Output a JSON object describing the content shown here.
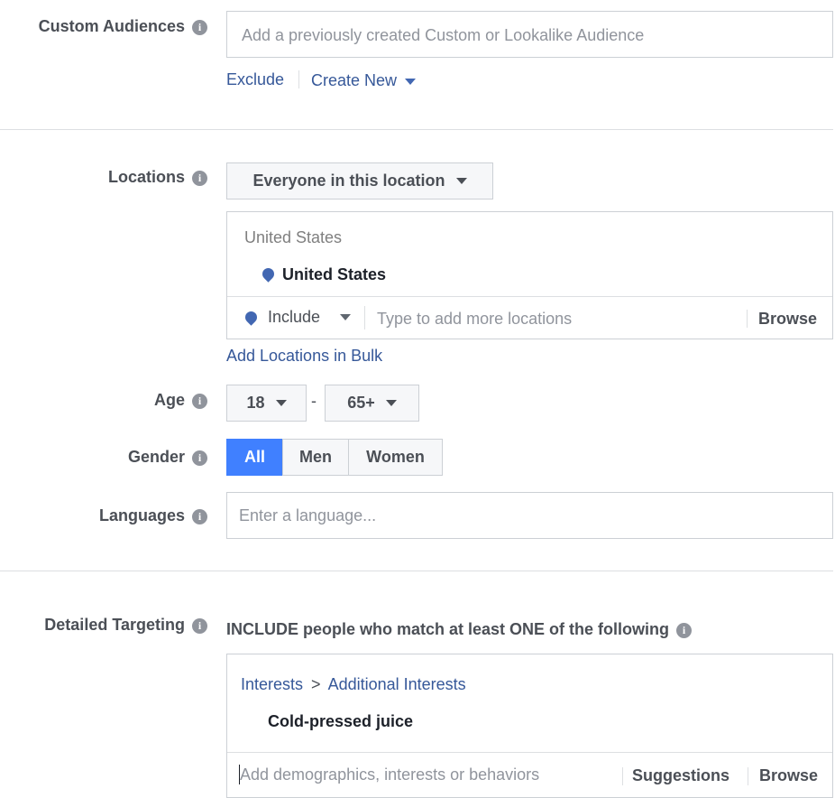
{
  "custom_audiences": {
    "label": "Custom Audiences",
    "info": "i",
    "placeholder": "Add a previously created Custom or Lookalike Audience",
    "exclude_label": "Exclude",
    "create_new_label": "Create New"
  },
  "locations": {
    "label": "Locations",
    "info": "i",
    "dropdown_label": "Everyone in this location",
    "group_header": "United States",
    "selected_location": "United States",
    "include_label": "Include",
    "input_placeholder": "Type to add more locations",
    "browse_label": "Browse",
    "bulk_link": "Add Locations in Bulk"
  },
  "age": {
    "label": "Age",
    "info": "i",
    "min": "18",
    "separator": "-",
    "max": "65+"
  },
  "gender": {
    "label": "Gender",
    "info": "i",
    "options": [
      "All",
      "Men",
      "Women"
    ],
    "selected": "All"
  },
  "languages": {
    "label": "Languages",
    "info": "i",
    "placeholder": "Enter a language..."
  },
  "detailed_targeting": {
    "label": "Detailed Targeting",
    "info": "i",
    "include_text": "INCLUDE people who match at least ONE of the following",
    "breadcrumb_root": "Interests",
    "breadcrumb_sep": ">",
    "breadcrumb_child": "Additional Interests",
    "selected_interest": "Cold-pressed juice",
    "input_placeholder": "Add demographics, interests or behaviors",
    "suggestions_label": "Suggestions",
    "browse_label": "Browse"
  },
  "colors": {
    "link": "#365899",
    "accent": "#4267b2",
    "selected_button": "#4080ff",
    "border": "#ccd0d5"
  }
}
